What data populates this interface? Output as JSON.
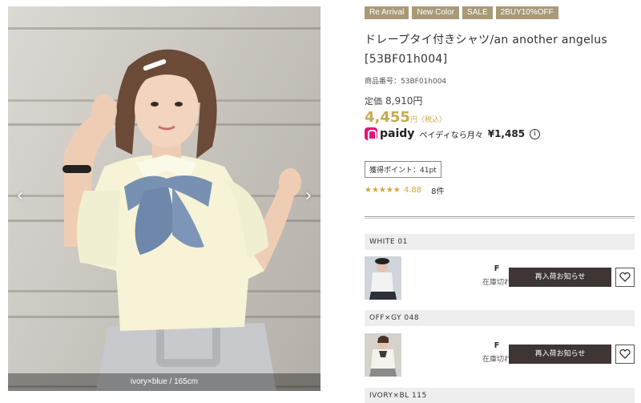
{
  "gallery": {
    "caption": "ivory×blue / 165cm",
    "prev_icon": "chevron-left-icon",
    "next_icon": "chevron-right-icon"
  },
  "product": {
    "tags": [
      "Re Arrival",
      "New Color",
      "SALE",
      "2BUY10%OFF"
    ],
    "title": "ドレープタイ付きシャツ/an another angelus [53BF01h004]",
    "sku_label": "商品番号：",
    "sku": "53BF01h004",
    "list_price_label": "定価",
    "list_price": "8,910円",
    "sale_price": "4,455",
    "sale_suffix": "円（税込）",
    "paidy": {
      "brand": "paidy",
      "text": "ペイディなら月々",
      "amount": "¥1,485",
      "info_icon": "i"
    },
    "points": "獲得ポイント：41pt",
    "rating": {
      "stars": "★★★★★",
      "value": "4.88",
      "count": "8件"
    }
  },
  "variants": [
    {
      "name": "WHITE 01",
      "size": "F",
      "stock": "在庫切れ",
      "button": "再入荷お知らせ"
    },
    {
      "name": "OFF×GY 048",
      "size": "F",
      "stock": "在庫切れ",
      "button": "再入荷お知らせ"
    },
    {
      "name": "IVORY×BL 115"
    }
  ],
  "colors": {
    "tag_bg": "#a89a77",
    "sale_price": "#c9a94d",
    "star": "#d8a53a",
    "button_bg": "#3d3633",
    "paidy_pink": "#e4137a"
  }
}
